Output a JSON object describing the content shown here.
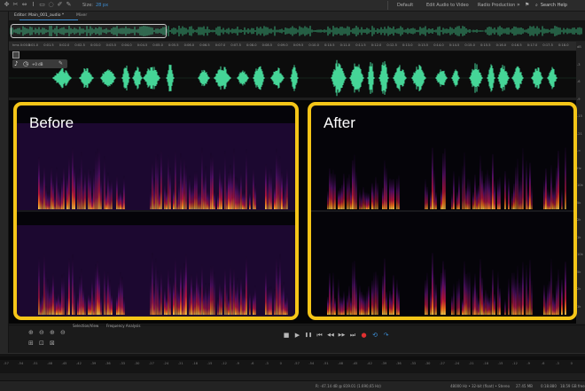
{
  "app": {
    "accent": "#3d8fd6",
    "highlight": "#f5c518"
  },
  "toolbar": {
    "tools": [
      "move-tool-icon",
      "razor-tool-icon",
      "slip-tool-icon",
      "time-selection-icon",
      "marquee-icon",
      "lasso-icon",
      "brush-icon",
      "spot-healing-icon"
    ],
    "size_label": "Size:",
    "size_value": "28 px"
  },
  "workspaces": [
    "Default",
    "Edit Audio to Video",
    "Radio Production"
  ],
  "search_label": "Search Help",
  "tabs": [
    {
      "label": "Editor: Main_001_audio *"
    },
    {
      "label": "Mixer"
    }
  ],
  "ruler": {
    "labels": [
      "hms 0:00.5",
      "0:01.0",
      "0:01.5",
      "0:02.0",
      "0:02.5",
      "0:03.0",
      "0:03.5",
      "0:04.0",
      "0:04.5",
      "0:05.0",
      "0:05.5",
      "0:06.0",
      "0:06.5",
      "0:07.0",
      "0:07.5",
      "0:08.0",
      "0:08.5",
      "0:09.0",
      "0:09.5",
      "0:10.0",
      "0:10.5",
      "0:11.0",
      "0:11.5",
      "0:12.0",
      "0:12.5",
      "0:13.0",
      "0:13.5",
      "0:14.0",
      "0:14.5",
      "0:15.0",
      "0:15.5",
      "0:16.0",
      "0:16.5",
      "0:17.0",
      "0:17.5",
      "0:18.0"
    ]
  },
  "track": {
    "gain": "+0 dB"
  },
  "panels": [
    {
      "label": "Before"
    },
    {
      "label": "After"
    }
  ],
  "right_scale": [
    "dB",
    "-3",
    "-6",
    "-9",
    "-15",
    "-21",
    "-∞",
    "Hz",
    "10k",
    "5k",
    "2k",
    "1k",
    "10k",
    "5k",
    "2k",
    "1k"
  ],
  "transport": {
    "tabs": [
      "Selection/View",
      "Frequency Analysis"
    ],
    "buttons": [
      "stop-icon",
      "play-icon",
      "pause-icon",
      "go-to-start-icon",
      "rewind-icon",
      "fast-forward-icon",
      "go-to-end-icon",
      "record-icon",
      "loop-icon",
      "skip-selection-icon"
    ]
  },
  "bottom_ruler": {
    "labels": [
      "-57",
      "-54",
      "-51",
      "-48",
      "-45",
      "-42",
      "-39",
      "-36",
      "-33",
      "-30",
      "-27",
      "-24",
      "-21",
      "-18",
      "-15",
      "-12",
      "-9",
      "-6",
      "-3",
      "0",
      "-57",
      "-54",
      "-51",
      "-48",
      "-45",
      "-42",
      "-39",
      "-36",
      "-33",
      "-30",
      "-27",
      "-24",
      "-21",
      "-18",
      "-15",
      "-12",
      "-9",
      "-6",
      "-3",
      "0"
    ]
  },
  "status": {
    "readout": "R: -47.14 dB @ 819.01 (1.690,65 Hz)",
    "sample_rate": "48000 Hz • 32-bit (float) • Stereo",
    "file_size": "27.45 MB",
    "duration": "0:18.880",
    "free_space": "18.59 GB free"
  }
}
